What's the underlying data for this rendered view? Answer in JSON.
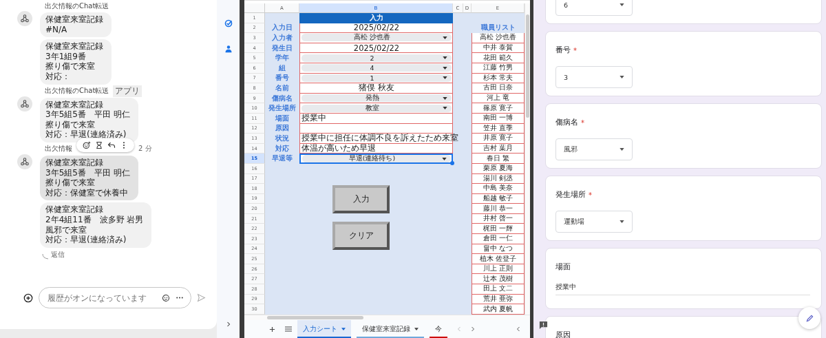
{
  "chat": {
    "groups": [
      {
        "sender": "出欠情報のChat転送",
        "messages": [
          {
            "lines": [
              "保健室来室記録",
              "#N/A"
            ],
            "highlighted": false
          },
          {
            "lines": [
              "保健室来室記録",
              "3年1組9番",
              "擦り傷で来室",
              "対応："
            ],
            "highlighted": false
          }
        ]
      },
      {
        "sender": "出欠情報のChat転送",
        "badge": "アプリ",
        "messages": [
          {
            "lines": [
              "保健室来室記録",
              "3年5組5番　平田 明仁",
              "擦り傷で来室",
              "対応：早退(連絡済み)"
            ],
            "highlighted": false
          }
        ]
      },
      {
        "sender": "出欠情報",
        "time": "2 分",
        "messages": [
          {
            "lines": [
              "保健室来室記録",
              "3年5組5番　平田 明仁",
              "擦り傷で来室",
              "対応：保健室で休養中"
            ],
            "highlighted": true
          },
          {
            "lines": [
              "保健室来室記録",
              "2年4組11番　波多野 岩男",
              "風邪で来室",
              "対応：早退(連絡済み)"
            ],
            "highlighted": false
          }
        ]
      }
    ],
    "reply_link": "返信",
    "input": {
      "placeholder": "履歴がオンになっています"
    }
  },
  "sheet": {
    "columns": [
      {
        "label": "A",
        "selected": false
      },
      {
        "label": "B",
        "selected": true
      },
      {
        "label": "C",
        "selected": false
      },
      {
        "label": "D",
        "selected": false
      },
      {
        "label": "E",
        "selected": false
      }
    ],
    "row_numbers": [
      {
        "number": "1",
        "selected": false
      },
      {
        "number": "2",
        "selected": false
      },
      {
        "number": "3",
        "selected": false
      },
      {
        "number": "4",
        "selected": false
      },
      {
        "number": "5",
        "selected": false
      },
      {
        "number": "6",
        "selected": false
      },
      {
        "number": "7",
        "selected": false
      },
      {
        "number": "8",
        "selected": false
      },
      {
        "number": "9",
        "selected": false
      },
      {
        "number": "10",
        "selected": false
      },
      {
        "number": "11",
        "selected": false
      },
      {
        "number": "12",
        "selected": false
      },
      {
        "number": "13",
        "selected": false
      },
      {
        "number": "14",
        "selected": false
      },
      {
        "number": "15",
        "selected": true
      },
      {
        "number": "16",
        "selected": false
      },
      {
        "number": "17",
        "selected": false
      },
      {
        "number": "18",
        "selected": false
      },
      {
        "number": "19",
        "selected": false
      },
      {
        "number": "20",
        "selected": false
      },
      {
        "number": "21",
        "selected": false
      },
      {
        "number": "22",
        "selected": false
      },
      {
        "number": "23",
        "selected": false
      },
      {
        "number": "24",
        "selected": false
      },
      {
        "number": "25",
        "selected": false
      },
      {
        "number": "26",
        "selected": false
      },
      {
        "number": "27",
        "selected": false
      },
      {
        "number": "28",
        "selected": false
      },
      {
        "number": "29",
        "selected": false
      },
      {
        "number": "30",
        "selected": false
      }
    ],
    "title": "入力",
    "fields": [
      {
        "label": "入力日",
        "value": "2025/02/22",
        "kind": "plain"
      },
      {
        "label": "入力者",
        "value": "高松 沙也香",
        "kind": "select"
      },
      {
        "label": "発生日",
        "value": "2025/02/22",
        "kind": "plain"
      },
      {
        "label": "学年",
        "value": "2",
        "kind": "select"
      },
      {
        "label": "組",
        "value": "4",
        "kind": "select"
      },
      {
        "label": "番号",
        "value": "1",
        "kind": "select"
      },
      {
        "label": "名前",
        "value": "猪俣 秋友",
        "kind": "plain"
      },
      {
        "label": "傷病名",
        "value": "発熱",
        "kind": "select"
      },
      {
        "label": "発生場所",
        "value": "教室",
        "kind": "select"
      },
      {
        "label": "場面",
        "value": "授業中",
        "kind": "text"
      },
      {
        "label": "原因",
        "kind": "text"
      },
      {
        "label": "状況",
        "value": "授業中に担任に体調不良を訴えたため来室",
        "kind": "text"
      },
      {
        "label": "対応",
        "value": "体温が高いため早退",
        "kind": "text"
      },
      {
        "label": "早退等",
        "value": "早退(連絡待ち)",
        "kind": "select"
      }
    ],
    "staff_list": {
      "title": "職員リスト",
      "names": [
        "高松 沙也香",
        "中井 泰賀",
        "花田 範久",
        "江藤 竹男",
        "杉本 常夫",
        "古田 日奈",
        "河上 竜",
        "篠原 寛子",
        "南田 一博",
        "笠井 直季",
        "井原 寛子",
        "吉村 葉月",
        "春日 繁",
        "栗原 夏海",
        "湯川 剣丞",
        "中島 美奈",
        "船越 敏子",
        "藤川 恭一",
        "井村 啓一",
        "梶田 一輝",
        "倉田 一仁",
        "畠中 なつ",
        "植木 佐登子",
        "川上 正則",
        "辻本 茂樹",
        "田上 文二",
        "荒井 亜弥",
        "武内 夏帆"
      ]
    },
    "buttons": [
      "入力",
      "クリア"
    ],
    "tabs": [
      {
        "label": "入力シート",
        "selected": true,
        "color": "#1967d2",
        "menu": true
      },
      {
        "label": "保健室来室記録",
        "selected": false,
        "color": "#6fa8dc",
        "menu": true
      },
      {
        "label": "今",
        "selected": false,
        "color": "#cc0000",
        "menu": false
      }
    ]
  },
  "form": {
    "cards": [
      {
        "kind": "select",
        "value": "6"
      },
      {
        "kind": "select",
        "label": "番号",
        "required_mark": "*",
        "value": "3"
      },
      {
        "kind": "select",
        "label": "傷病名",
        "required_mark": "*",
        "value": "風邪"
      },
      {
        "kind": "select",
        "label": "発生場所",
        "required_mark": "*",
        "value": "運動場"
      },
      {
        "kind": "text",
        "label": "場面",
        "value": "授業中"
      },
      {
        "kind": "text",
        "label": "原因"
      }
    ]
  }
}
